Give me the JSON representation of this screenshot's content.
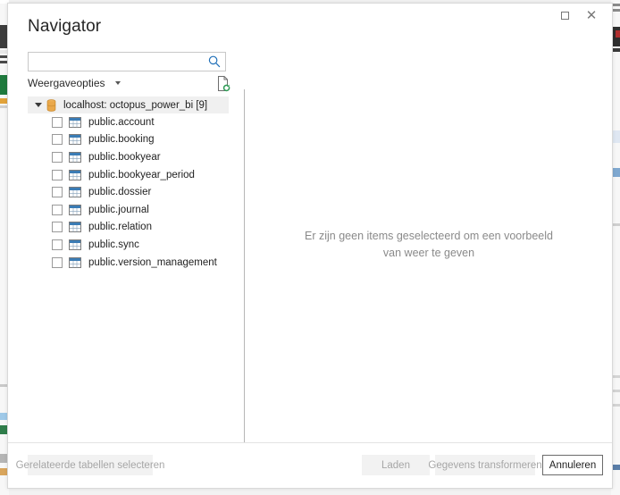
{
  "window": {
    "title": "Navigator",
    "maximize_label": "Maximaliseren",
    "close_label": "Sluiten",
    "close_glyph": "✕"
  },
  "left_pane": {
    "search": {
      "value": "",
      "placeholder": "",
      "icon": "search-icon"
    },
    "view_options": {
      "label": "Weergaveopties",
      "caret_icon": "chevron-down-icon"
    },
    "refresh_button": {
      "icon": "refresh-document-icon",
      "tooltip": "Vernieuwen"
    },
    "tree": {
      "root": {
        "label": "localhost: octopus_power_bi [9]",
        "icon": "database-icon",
        "expander_icon": "triangle-down-icon",
        "expanded": true
      },
      "items": [
        {
          "label": "public.account",
          "icon": "table-icon",
          "checked": false
        },
        {
          "label": "public.booking",
          "icon": "table-icon",
          "checked": false
        },
        {
          "label": "public.bookyear",
          "icon": "table-icon",
          "checked": false
        },
        {
          "label": "public.bookyear_period",
          "icon": "table-icon",
          "checked": false
        },
        {
          "label": "public.dossier",
          "icon": "table-icon",
          "checked": false
        },
        {
          "label": "public.journal",
          "icon": "table-icon",
          "checked": false
        },
        {
          "label": "public.relation",
          "icon": "table-icon",
          "checked": false
        },
        {
          "label": "public.sync",
          "icon": "table-icon",
          "checked": false
        },
        {
          "label": "public.version_management",
          "icon": "table-icon",
          "checked": false
        }
      ]
    }
  },
  "right_pane": {
    "empty_message": "Er zijn geen items geselecteerd om een voorbeeld van weer te geven"
  },
  "footer": {
    "select_related_label": "Gerelateerde tabellen selecteren",
    "load_label": "Laden",
    "transform_label": "Gegevens transformeren",
    "cancel_label": "Annuleren"
  },
  "colors": {
    "accent": "#0f6cbd",
    "database_icon": "#e8a33d",
    "table_icon_header": "#2a6ea8",
    "divider": "#b6b6b6",
    "muted_text": "#8a8a8a",
    "disabled_button_bg": "#f2f2f2"
  }
}
